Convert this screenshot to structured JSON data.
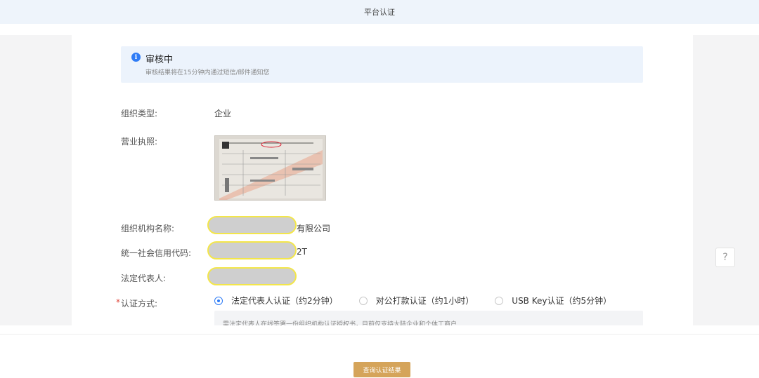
{
  "header": {
    "title": "平台认证"
  },
  "notice": {
    "title": "审核中",
    "subtitle": "审核结果将在15分钟内通过短信/邮件通知您",
    "icon": "info-icon"
  },
  "form": {
    "org_type": {
      "label": "组织类型:",
      "value": "企业"
    },
    "license": {
      "label": "营业执照:"
    },
    "org_name": {
      "label": "组织机构名称:",
      "value_suffix": "有限公司"
    },
    "credit_code": {
      "label": "统一社会信用代码:",
      "value_suffix": "2T"
    },
    "legal_rep": {
      "label": "法定代表人:"
    },
    "auth_method": {
      "required_mark": "*",
      "label": "认证方式:",
      "options": [
        {
          "label": "法定代表人认证（约2分钟）",
          "selected": true
        },
        {
          "label": "对公打款认证（约1小时）",
          "selected": false
        },
        {
          "label": "USB Key认证（约5分钟）",
          "selected": false
        }
      ],
      "hint": "需法定代表人在线签署一份组织机构认证授权书，目前仅支持大陆企业和个体工商户"
    }
  },
  "help": {
    "label": "?"
  },
  "footer": {
    "query_button": "查询认证结果"
  },
  "colors": {
    "accent": "#2f7cf6",
    "button": "#d5a45a",
    "mask_border": "#f3e64a"
  }
}
